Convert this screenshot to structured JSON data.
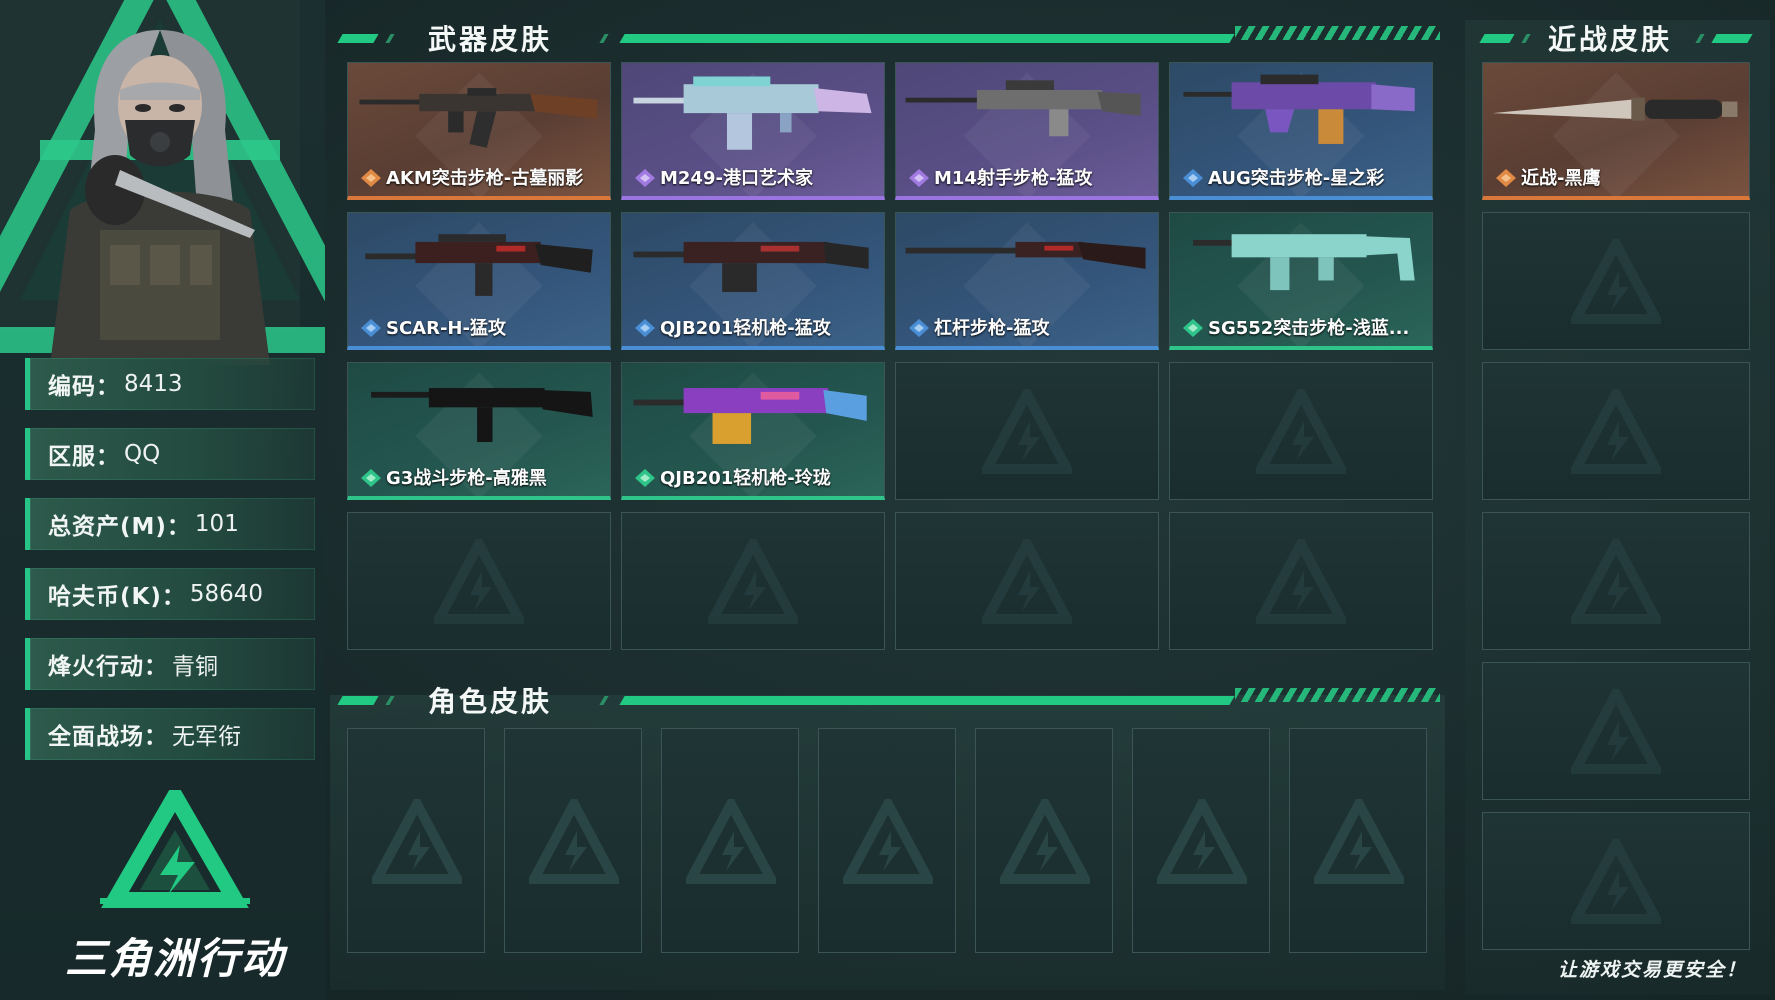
{
  "profile": {
    "rows": [
      {
        "label": "编码：",
        "value": "8413"
      },
      {
        "label": "区服：",
        "value": "QQ"
      },
      {
        "label": "总资产(M)：",
        "value": "101"
      },
      {
        "label": "哈夫币(K)：",
        "value": "58640"
      },
      {
        "label": "烽火行动：",
        "value": "青铜"
      },
      {
        "label": "全面战场：",
        "value": "无军衔"
      }
    ],
    "logo_text": "三角洲行动"
  },
  "weapon_section": {
    "title": "武器皮肤",
    "cards": [
      {
        "name": "AKM突击步枪-古墓丽影",
        "rarity": "orange",
        "icon": "rifle-icon"
      },
      {
        "name": "M249-港口艺术家",
        "rarity": "purple",
        "icon": "machine-gun-icon"
      },
      {
        "name": "M14射手步枪-猛攻",
        "rarity": "purple",
        "icon": "marksman-rifle-icon"
      },
      {
        "name": "AUG突击步枪-星之彩",
        "rarity": "blue",
        "icon": "bullpup-rifle-icon"
      },
      {
        "name": "SCAR-H-猛攻",
        "rarity": "blue",
        "icon": "rifle-icon"
      },
      {
        "name": "QJB201轻机枪-猛攻",
        "rarity": "blue",
        "icon": "machine-gun-icon"
      },
      {
        "name": "杠杆步枪-猛攻",
        "rarity": "blue",
        "icon": "lever-rifle-icon"
      },
      {
        "name": "SG552突击步枪-浅蓝...",
        "rarity": "green",
        "icon": "rifle-icon"
      },
      {
        "name": "G3战斗步枪-高雅黑",
        "rarity": "green",
        "icon": "rifle-icon"
      },
      {
        "name": "QJB201轻机枪-玲珑",
        "rarity": "green",
        "icon": "machine-gun-icon"
      }
    ],
    "empty_slots": 6
  },
  "character_section": {
    "title": "角色皮肤",
    "empty_slots": 7
  },
  "melee_section": {
    "title": "近战皮肤",
    "cards": [
      {
        "name": "近战-黑鹰",
        "rarity": "orange",
        "icon": "knife-icon"
      }
    ],
    "empty_slots": 5
  },
  "footer": {
    "note": "让游戏交易更安全！"
  },
  "colors": {
    "accent": "#22c983",
    "orange": "#d9783a",
    "purple": "#9a74e0",
    "blue": "#4a8fd6",
    "green": "#2ec48a"
  }
}
